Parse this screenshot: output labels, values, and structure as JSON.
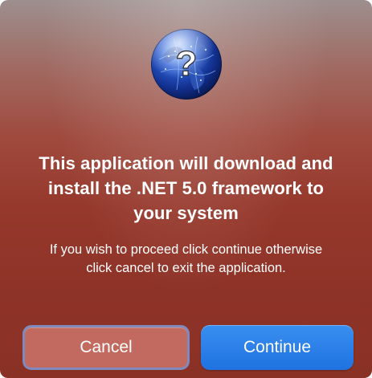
{
  "dialog": {
    "icon": "globe-question-icon",
    "title": "This application will download and install the .NET 5.0 framework to your system",
    "message": "If you wish to proceed click continue otherwise click cancel to exit the application.",
    "buttons": {
      "cancel_label": "Cancel",
      "continue_label": "Continue"
    }
  },
  "colors": {
    "background_top": "#9d8f8e",
    "background_bottom": "#8a3125",
    "cancel_button": "#c36a60",
    "continue_button": "#2a80e8",
    "focus_ring": "#7e89bd"
  }
}
